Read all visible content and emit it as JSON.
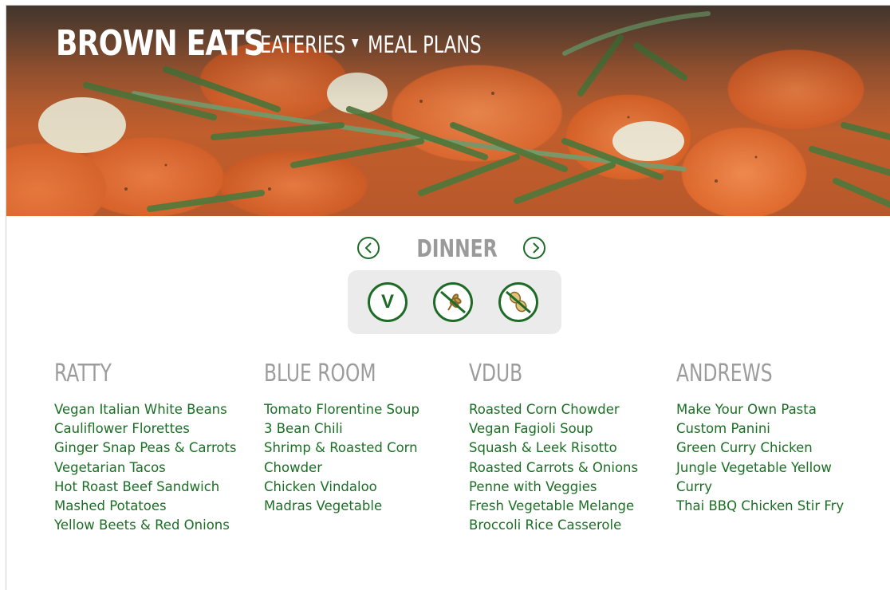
{
  "header": {
    "brand": "BROWN EATS",
    "nav": [
      {
        "label": "EATERIES",
        "has_dropdown": true
      },
      {
        "label": "MEAL PLANS",
        "has_dropdown": false
      }
    ]
  },
  "meal_selector": {
    "current_meal": "DINNER",
    "prev_icon": "chevron-left-circle-icon",
    "next_icon": "chevron-right-circle-icon"
  },
  "filters": [
    {
      "name": "vegan-filter",
      "symbol": "V",
      "icon": "vegan-icon"
    },
    {
      "name": "gluten-free-filter",
      "icon": "no-wheat-icon"
    },
    {
      "name": "nut-free-filter",
      "icon": "no-peanut-icon"
    }
  ],
  "halls": [
    {
      "name": "RATTY",
      "items": [
        "Vegan Italian White Beans",
        "Cauliflower Florettes",
        "Ginger Snap Peas & Carrots",
        "Vegetarian Tacos",
        "Hot Roast Beef Sandwich",
        "Mashed Potatoes",
        "Yellow Beets & Red Onions"
      ]
    },
    {
      "name": "BLUE ROOM",
      "items": [
        "Tomato Florentine Soup",
        "3 Bean Chili",
        "Shrimp & Roasted Corn Chowder",
        "Chicken Vindaloo",
        "Madras Vegetable"
      ]
    },
    {
      "name": "VDUB",
      "items": [
        "Roasted Corn Chowder",
        "Vegan Fagioli Soup",
        "Squash & Leek Risotto",
        "Roasted Carrots & Onions",
        "Penne with Veggies",
        "Fresh Vegetable Melange",
        "Broccoli Rice Casserole"
      ]
    },
    {
      "name": "ANDREWS",
      "items": [
        "Make Your Own Pasta",
        "Custom Panini",
        "Green Curry Chicken",
        "Jungle Vegetable Yellow Curry",
        "Thai BBQ Chicken Stir Fry"
      ]
    }
  ],
  "colors": {
    "accent_green": "#1d6b27",
    "heading_gray": "#9c9c9c",
    "filter_bg": "#ebebeb"
  }
}
